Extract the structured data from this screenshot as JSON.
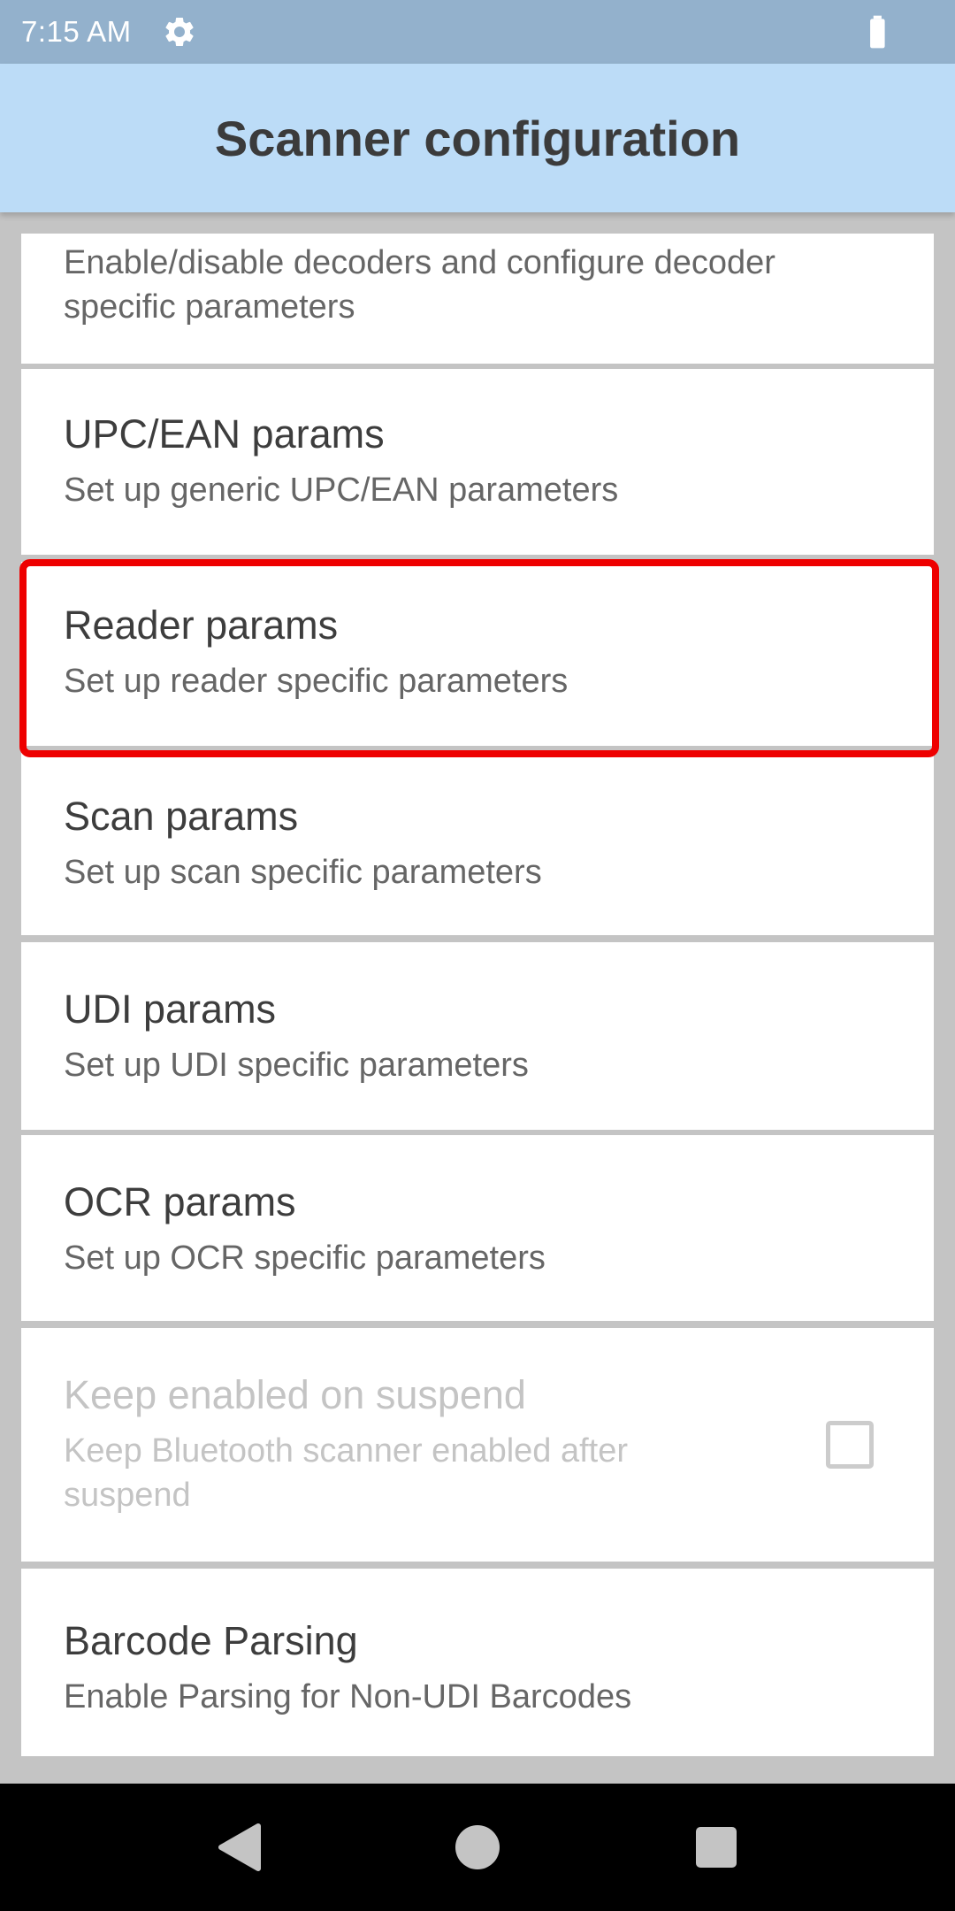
{
  "status_bar": {
    "time": "7:15 AM",
    "settings_icon": "gear-icon",
    "battery_icon": "battery-full-icon",
    "color": "#93b1cc"
  },
  "app_bar": {
    "title": "Scanner configuration",
    "color": "#bcdcf7"
  },
  "list": {
    "items": [
      {
        "title": "",
        "summary": "Enable/disable decoders and configure decoder\nspecific parameters"
      },
      {
        "title": "UPC/EAN params",
        "summary": "Set up generic UPC/EAN parameters"
      },
      {
        "title": "Reader params",
        "summary": "Set up reader specific parameters",
        "highlighted": true
      },
      {
        "title": "Scan params",
        "summary": "Set up scan specific parameters"
      },
      {
        "title": "UDI params",
        "summary": "Set up UDI specific parameters"
      },
      {
        "title": "OCR params",
        "summary": "Set up OCR specific parameters"
      },
      {
        "title": "Keep enabled on suspend",
        "summary_line1": "Keep Bluetooth scanner enabled after",
        "summary_line2": "suspend",
        "disabled": true,
        "checked": false
      },
      {
        "title": "Barcode Parsing",
        "summary": "Enable Parsing for Non-UDI Barcodes"
      }
    ]
  },
  "highlight_color": "#ee0000",
  "nav_bar": {
    "back_icon": "back-triangle-icon",
    "home_icon": "home-circle-icon",
    "recents_icon": "recents-square-icon"
  }
}
